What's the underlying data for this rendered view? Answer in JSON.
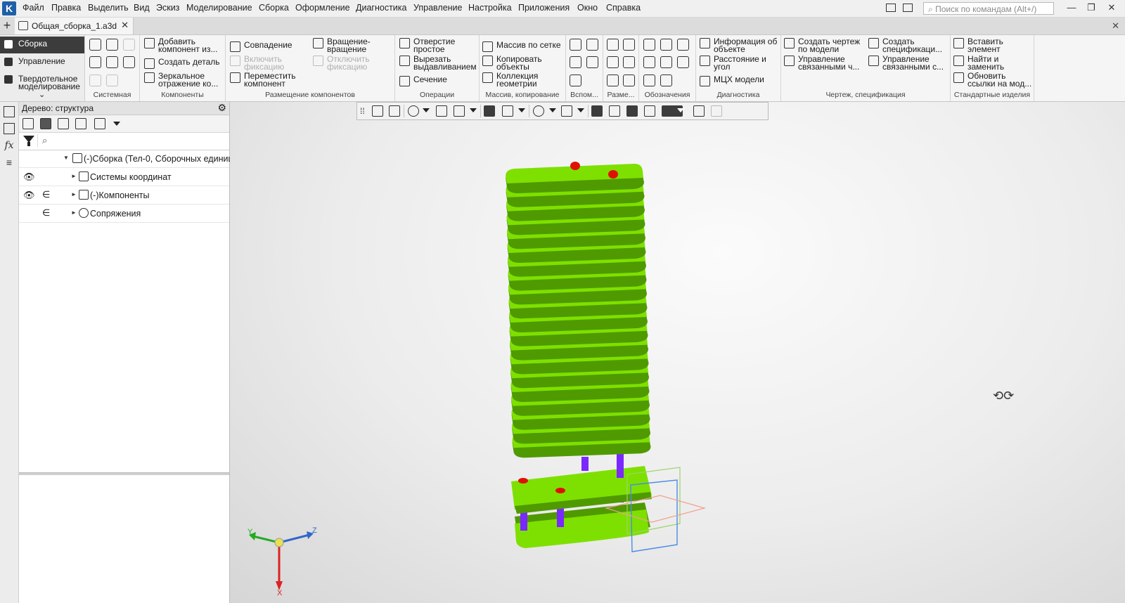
{
  "menubar": {
    "logo": "K",
    "items": [
      "Файл",
      "Правка",
      "Выделить",
      "Вид",
      "Эскиз",
      "Моделирование",
      "Сборка",
      "Оформление",
      "Диагностика",
      "Управление",
      "Настройка",
      "Приложения",
      "Окно",
      "Справка"
    ],
    "search_placeholder": "Поиск по командам (Alt+/)",
    "minimize": "—",
    "maximize": "❐",
    "close": "✕"
  },
  "tabs": {
    "new_tab": "+",
    "document": "Общая_сборка_1.a3d",
    "close": "✕",
    "bar_close": "✕"
  },
  "ribbon": {
    "modes": [
      "Сборка",
      "Управление",
      "Твердотельное моделирование"
    ],
    "collapse": "⌄",
    "groups": {
      "system": "Системная",
      "components": "Компоненты",
      "placement": "Размещение компонентов",
      "operations": "Операции",
      "array": "Массив, копирование",
      "aux": "Вспом...",
      "dims": "Разме...",
      "notation": "Обозначения",
      "diagnostics": "Диагностика",
      "drawing": "Чертеж, спецификация",
      "standard": "Стандартные изделия"
    },
    "buttons": {
      "add_component": [
        "Добавить",
        "компонент из..."
      ],
      "create_part": "Создать деталь",
      "mirror": [
        "Зеркальное",
        "отражение ко..."
      ],
      "coincidence": "Совпадение",
      "rotation": [
        "Вращение-",
        "вращение"
      ],
      "enable_fix": [
        "Включить",
        "фиксацию"
      ],
      "disable_fix": [
        "Отключить",
        "фиксацию"
      ],
      "move_component": [
        "Переместить",
        "компонент"
      ],
      "simple_hole": [
        "Отверстие",
        "простое"
      ],
      "extrude_cut": [
        "Вырезать",
        "выдавливанием"
      ],
      "section": "Сечение",
      "grid_array": "Массив по сетке",
      "copy_objects": [
        "Копировать",
        "объекты"
      ],
      "geometry_collection": [
        "Коллекция",
        "геометрии"
      ],
      "object_info": [
        "Информация об",
        "объекте"
      ],
      "distance_angle": [
        "Расстояние и",
        "угол"
      ],
      "mass_properties": "МЦХ модели",
      "create_drawing": [
        "Создать чертеж",
        "по модели"
      ],
      "create_spec": [
        "Создать",
        "спецификаци..."
      ],
      "manage_linked_1": [
        "Управление",
        "связанными ч..."
      ],
      "manage_linked_2": [
        "Управление",
        "связанными с..."
      ],
      "insert_element": [
        "Вставить",
        "элемент"
      ],
      "find_replace": [
        "Найти и",
        "заменить"
      ],
      "update_links": [
        "Обновить",
        "ссылки на мод..."
      ]
    }
  },
  "tree": {
    "header": "Дерево: структура",
    "gear": "⚙",
    "search_icon": "⌕",
    "rows": [
      {
        "label": "(-)Сборка (Тел-0, Сборочных единиц"
      },
      {
        "label": "Системы координат"
      },
      {
        "label": "(-)Компоненты"
      },
      {
        "label": "Сопряжения"
      }
    ],
    "eye": "👁",
    "include": "∈",
    "expand_open": "▼",
    "expand_closed": "►"
  },
  "viewport": {
    "axis_x": "X",
    "axis_y": "Y",
    "axis_z": "Z",
    "rotate_cursor": "⟲⟳",
    "colors": {
      "plate": "#7ee000",
      "plate_dark": "#4f9a00",
      "pin": "#7a28ff",
      "cap": "#e01000"
    }
  }
}
